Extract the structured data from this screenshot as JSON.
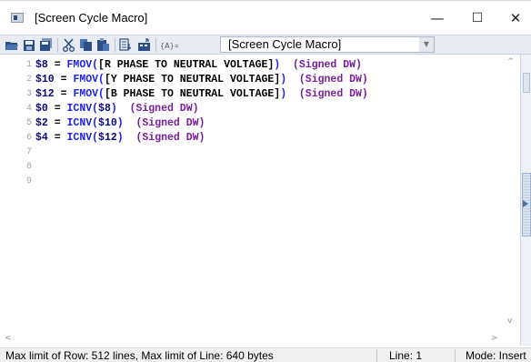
{
  "window": {
    "title": "[Screen Cycle Macro]",
    "minimize_glyph": "—",
    "maximize_glyph": "☐",
    "close_glyph": "✕"
  },
  "toolbar": {
    "macro_select_value": "[Screen Cycle Macro]",
    "icons": [
      "open-folder-icon",
      "save-icon",
      "save-all-icon",
      "cut-icon",
      "copy-icon",
      "paste-icon",
      "insert-icon",
      "device-icon",
      "address-icon"
    ]
  },
  "editor": {
    "line_numbers": [
      "1",
      "2",
      "3",
      "4",
      "5",
      "6",
      "7",
      "8",
      "9"
    ],
    "lines": [
      [
        {
          "t": "$8",
          "c": "var"
        },
        {
          "t": " = ",
          "c": "op"
        },
        {
          "t": "FMOV",
          "c": "fn"
        },
        {
          "t": "(",
          "c": "paren"
        },
        {
          "t": "[R PHASE TO NEUTRAL VOLTAGE]",
          "c": "brk"
        },
        {
          "t": ")",
          "c": "paren"
        },
        {
          "t": "  ",
          "c": "sp"
        },
        {
          "t": "(Signed DW)",
          "c": "type"
        }
      ],
      [
        {
          "t": "$10",
          "c": "var"
        },
        {
          "t": " = ",
          "c": "op"
        },
        {
          "t": "FMOV",
          "c": "fn"
        },
        {
          "t": "(",
          "c": "paren"
        },
        {
          "t": "[Y PHASE TO NEUTRAL VOLTAGE]",
          "c": "brk"
        },
        {
          "t": ")",
          "c": "paren"
        },
        {
          "t": "  ",
          "c": "sp"
        },
        {
          "t": "(Signed DW)",
          "c": "type"
        }
      ],
      [
        {
          "t": "$12",
          "c": "var"
        },
        {
          "t": " = ",
          "c": "op"
        },
        {
          "t": "FMOV",
          "c": "fn"
        },
        {
          "t": "(",
          "c": "paren"
        },
        {
          "t": "[B PHASE TO NEUTRAL VOLTAGE]",
          "c": "brk"
        },
        {
          "t": ")",
          "c": "paren"
        },
        {
          "t": "  ",
          "c": "sp"
        },
        {
          "t": "(Signed DW)",
          "c": "type"
        }
      ],
      [
        {
          "t": "$0",
          "c": "var"
        },
        {
          "t": " = ",
          "c": "op"
        },
        {
          "t": "ICNV",
          "c": "fn"
        },
        {
          "t": "(",
          "c": "paren"
        },
        {
          "t": "$8",
          "c": "var"
        },
        {
          "t": ")",
          "c": "paren"
        },
        {
          "t": "  ",
          "c": "sp"
        },
        {
          "t": "(Signed DW)",
          "c": "type"
        }
      ],
      [
        {
          "t": "$2",
          "c": "var"
        },
        {
          "t": " = ",
          "c": "op"
        },
        {
          "t": "ICNV",
          "c": "fn"
        },
        {
          "t": "(",
          "c": "paren"
        },
        {
          "t": "$10",
          "c": "var"
        },
        {
          "t": ")",
          "c": "paren"
        },
        {
          "t": "  ",
          "c": "sp"
        },
        {
          "t": "(Signed DW)",
          "c": "type"
        }
      ],
      [
        {
          "t": "$4",
          "c": "var"
        },
        {
          "t": " = ",
          "c": "op"
        },
        {
          "t": "ICNV",
          "c": "fn"
        },
        {
          "t": "(",
          "c": "paren"
        },
        {
          "t": "$12",
          "c": "var"
        },
        {
          "t": ")",
          "c": "paren"
        },
        {
          "t": "  ",
          "c": "sp"
        },
        {
          "t": "(Signed DW)",
          "c": "type"
        }
      ]
    ]
  },
  "scrollbar": {
    "up_glyph": "^",
    "down_glyph": "v",
    "left_glyph": "<",
    "right_glyph": ">"
  },
  "status": {
    "limits": "Max limit of Row: 512 lines, Max limit of Line: 640 bytes",
    "line": "Line: 1",
    "mode": "Mode: Insert"
  }
}
